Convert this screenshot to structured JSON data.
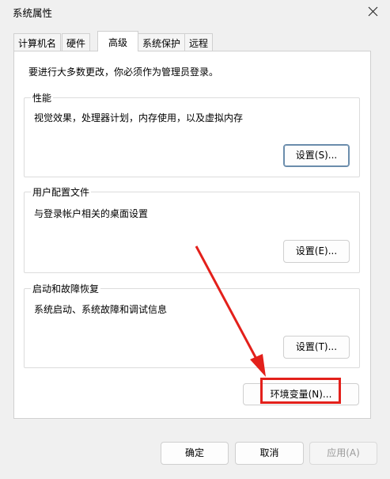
{
  "window": {
    "title": "系统属性"
  },
  "tabs": [
    {
      "label": "计算机名",
      "active": false
    },
    {
      "label": "硬件",
      "active": false
    },
    {
      "label": "高级",
      "active": true
    },
    {
      "label": "系统保护",
      "active": false
    },
    {
      "label": "远程",
      "active": false
    }
  ],
  "advanced": {
    "intro": "要进行大多数更改，你必须作为管理员登录。",
    "performance": {
      "title": "性能",
      "description": "视觉效果，处理器计划，内存使用，以及虚拟内存",
      "button": "设置(S)..."
    },
    "user_profiles": {
      "title": "用户配置文件",
      "description": "与登录帐户相关的桌面设置",
      "button": "设置(E)..."
    },
    "startup_recovery": {
      "title": "启动和故障恢复",
      "description": "系统启动、系统故障和调试信息",
      "button": "设置(T)..."
    },
    "env_button": "环境变量(N)..."
  },
  "footer": {
    "ok": "确定",
    "cancel": "取消",
    "apply": "应用(A)"
  },
  "colors": {
    "annotation": "#e3201b",
    "focus_border": "#6a8cab"
  }
}
